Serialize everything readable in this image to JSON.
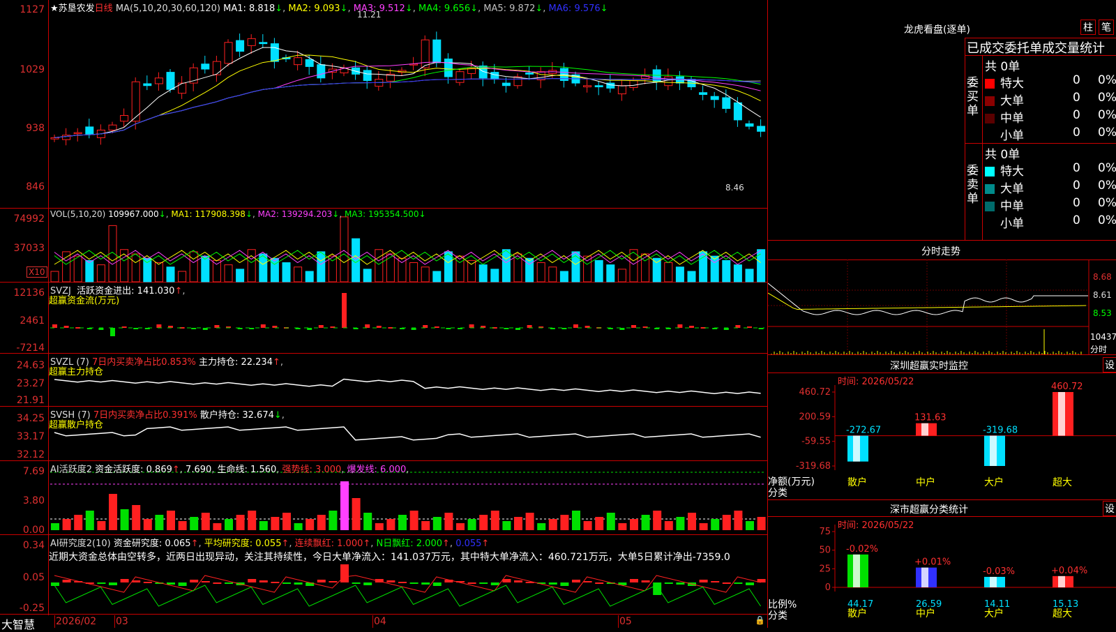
{
  "stock": {
    "name": "苏垦农发",
    "period": "日线",
    "ma_head": "MA(5,10,20,30,60,120)",
    "ma1": "MA1: 8.818",
    "ma2": "MA2: 9.093",
    "ma3": "MA3: 9.512",
    "ma4": "MA4: 9.656",
    "ma5": "MA5: 9.872",
    "ma6": "MA6: 9.576",
    "high_mark": "11.21",
    "low_mark": "8.46",
    "axis": [
      "1127",
      "1029",
      "938",
      "846"
    ]
  },
  "vol": {
    "head": "VOL(5,10,20)",
    "v": "109967.000",
    "ma1": "MA1: 117908.398",
    "ma2": "MA2: 139294.203",
    "ma3": "MA3: 195354.500",
    "axis": [
      "74992",
      "37033"
    ],
    "unit": "X10"
  },
  "svzj": {
    "head": "SVZJ",
    "label": "活跃资金进出: 141.030",
    "title": "超赢资金流(万元)",
    "axis": [
      "12136",
      "2461",
      "-7214"
    ]
  },
  "svzl": {
    "head": "SVZL (7)",
    "pct": "7日内买卖净占比0.853%",
    "label": "主力持仓: 22.234",
    "title": "超赢主力持仓",
    "axis": [
      "24.63",
      "23.27",
      "21.91"
    ]
  },
  "svsh": {
    "head": "SVSH (7)",
    "pct": "7日内买卖净占比0.391%",
    "label": "散户持仓: 32.674",
    "title": "超赢散户持仓",
    "axis": [
      "34.25",
      "33.17",
      "32.12"
    ]
  },
  "ai2": {
    "head": "AI活跃度2",
    "l1": "资金活跃度: 0.869",
    "l2": "7.690",
    "l3": "生命线: 1.560",
    "l4": "强势线: 3.000",
    "l5": "爆发线: 6.000",
    "axis": [
      "7.69",
      "3.80",
      "0.00"
    ]
  },
  "ai3": {
    "head": "AI研究度2(10)",
    "l1": "资金研究度: 0.065",
    "l2": "平均研究度: 0.055",
    "l3": "连续飘红: 1.000",
    "l4": "N日飘红: 2.000",
    "l5": "0.055",
    "comment": "近期大资金总体由空转多，近两日出现异动，关注其持续性，今日大单净流入：141.037万元，其中特大单净流入：460.721万元，大单5日累计净出-7359.0",
    "axis": [
      "0.34",
      "0.05",
      "-0.25"
    ]
  },
  "bottom": {
    "brand": "大智慧",
    "months": [
      "2026/02",
      "03",
      "04",
      "05"
    ]
  },
  "lhb": {
    "title": "龙虎看盘(逐单)",
    "tab1": "柱",
    "tab2": "笔",
    "header": "已成交委托单成交量统计",
    "buy_side": "委买单",
    "sell_side": "委卖单",
    "buy_total": "共 0单",
    "sell_total": "共 0单",
    "buy_rows": [
      {
        "name": "特大",
        "count": "0",
        "pct": "0%",
        "color": "#ff0000"
      },
      {
        "name": "大单",
        "count": "0",
        "pct": "0%",
        "color": "#8b0000"
      },
      {
        "name": "中单",
        "count": "0",
        "pct": "0%",
        "color": "#5a0000"
      },
      {
        "name": "小单",
        "count": "0",
        "pct": "0%",
        "color": "#000000"
      }
    ],
    "sell_rows": [
      {
        "name": "特大",
        "count": "0",
        "pct": "0%",
        "color": "#00ffff"
      },
      {
        "name": "大单",
        "count": "0",
        "pct": "0%",
        "color": "#008b8b"
      },
      {
        "name": "中单",
        "count": "0",
        "pct": "0%",
        "color": "#006b6b"
      },
      {
        "name": "小单",
        "count": "0",
        "pct": "0%",
        "color": "#000000"
      }
    ]
  },
  "intraday": {
    "title": "分时走势",
    "axis": [
      "8.68",
      "8.61",
      "8.53"
    ],
    "vol": "10437",
    "vol_unit": "分时"
  },
  "sz_monitor": {
    "title": "深圳超赢实时监控",
    "set": "设",
    "time": "时间: 2026/05/22",
    "axis": [
      "460.72",
      "200.59",
      "-59.55",
      "-319.68"
    ],
    "ylabel": "净额(万元)",
    "xlabel": "分类",
    "chart_data": {
      "type": "bar",
      "categories": [
        "散户",
        "中户",
        "大户",
        "超大"
      ],
      "values": [
        -272.67,
        131.63,
        -319.68,
        460.72
      ],
      "value_labels": [
        "-272.67",
        "131.63",
        "-319.68",
        "460.72"
      ],
      "ylim": [
        -319.68,
        460.72
      ]
    }
  },
  "sz_stat": {
    "title": "深市超赢分类统计",
    "set": "设",
    "time": "时间: 2026/05/22",
    "axis": [
      "75",
      "50",
      "25",
      "0"
    ],
    "ylabel": "比例%",
    "xlabel": "分类",
    "chart_data": {
      "type": "bar",
      "categories": [
        "散户",
        "中户",
        "大户",
        "超大"
      ],
      "values": [
        44.17,
        26.59,
        14.11,
        15.13
      ],
      "value_labels": [
        "44.17",
        "26.59",
        "14.11",
        "15.13"
      ],
      "changes": [
        "-0.02%",
        "+0.01%",
        "-0.03%",
        "+0.04%"
      ],
      "ylim": [
        0,
        75
      ]
    }
  }
}
